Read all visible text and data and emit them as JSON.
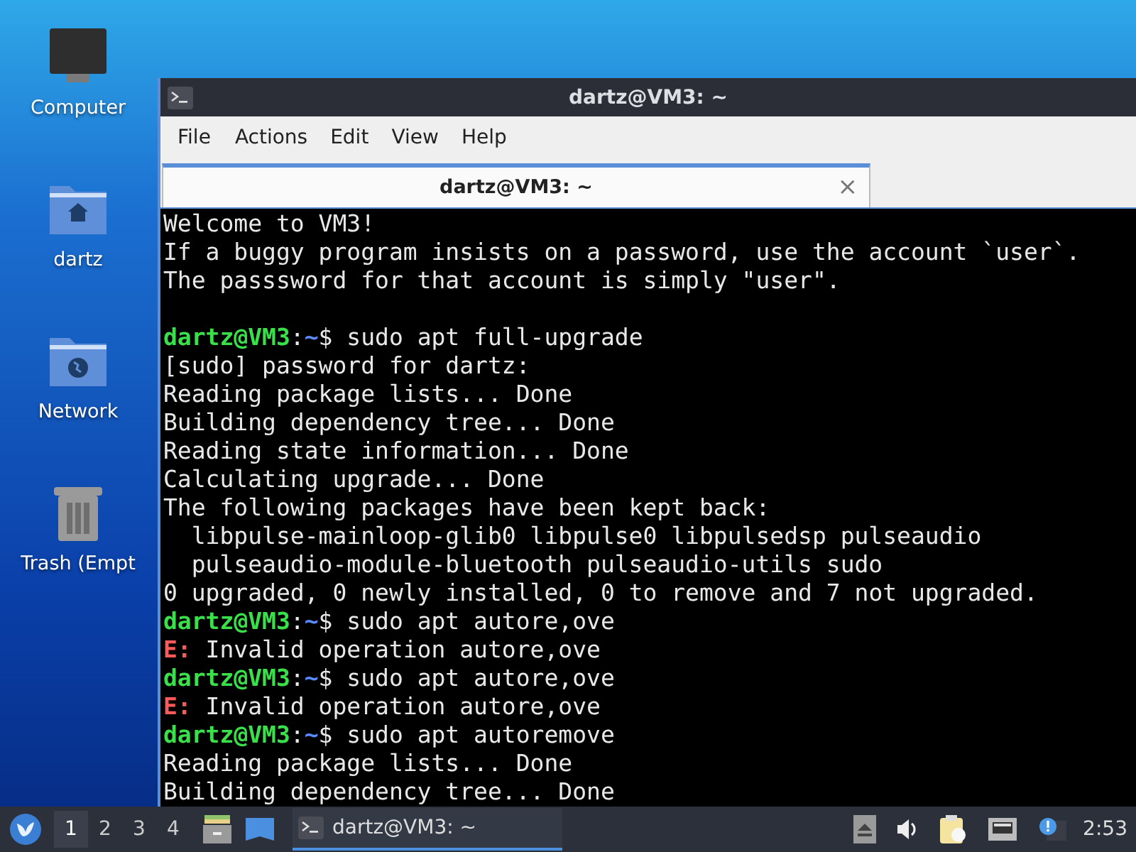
{
  "desktop_icons": [
    {
      "kind": "computer",
      "label": "Computer"
    },
    {
      "kind": "home",
      "label": "dartz"
    },
    {
      "kind": "network",
      "label": "Network"
    },
    {
      "kind": "trash",
      "label": "Trash (Empt"
    }
  ],
  "window": {
    "title": "dartz@VM3: ~"
  },
  "menu": [
    "File",
    "Actions",
    "Edit",
    "View",
    "Help"
  ],
  "tabs": [
    {
      "label": "dartz@VM3: ~",
      "close": "×",
      "selected": true
    }
  ],
  "terminal_lines": [
    {
      "kind": "plain",
      "text": "Welcome to VM3!"
    },
    {
      "kind": "plain",
      "text": "If a buggy program insists on a password, use the account `user`."
    },
    {
      "kind": "plain",
      "text": "The passsword for that account is simply \"user\"."
    },
    {
      "kind": "blank"
    },
    {
      "kind": "prompt",
      "user": "dartz@VM3",
      "sep": ":",
      "path": "~",
      "command": "$ sudo apt full-upgrade"
    },
    {
      "kind": "plain",
      "text": "[sudo] password for dartz:"
    },
    {
      "kind": "plain",
      "text": "Reading package lists... Done"
    },
    {
      "kind": "plain",
      "text": "Building dependency tree... Done"
    },
    {
      "kind": "plain",
      "text": "Reading state information... Done"
    },
    {
      "kind": "plain",
      "text": "Calculating upgrade... Done"
    },
    {
      "kind": "plain",
      "text": "The following packages have been kept back:"
    },
    {
      "kind": "indented",
      "text": "libpulse-mainloop-glib0 libpulse0 libpulsedsp pulseaudio"
    },
    {
      "kind": "indented",
      "text": "pulseaudio-module-bluetooth pulseaudio-utils sudo"
    },
    {
      "kind": "plain",
      "text": "0 upgraded, 0 newly installed, 0 to remove and 7 not upgraded."
    },
    {
      "kind": "prompt",
      "user": "dartz@VM3",
      "sep": ":",
      "path": "~",
      "command": "$ sudo apt autore,ove"
    },
    {
      "kind": "error",
      "prefix": "E:",
      "text": "Invalid operation autore,ove"
    },
    {
      "kind": "prompt",
      "user": "dartz@VM3",
      "sep": ":",
      "path": "~",
      "command": "$ sudo apt autore,ove"
    },
    {
      "kind": "error",
      "prefix": "E:",
      "text": "Invalid operation autore,ove"
    },
    {
      "kind": "prompt",
      "user": "dartz@VM3",
      "sep": ":",
      "path": "~",
      "command": "$ sudo apt autoremove"
    },
    {
      "kind": "plain",
      "text": "Reading package lists... Done"
    },
    {
      "kind": "plain",
      "text": "Building dependency tree... Done"
    }
  ],
  "taskbar": {
    "workspaces": [
      {
        "label": "1",
        "selected": true
      },
      {
        "label": "2",
        "selected": false
      },
      {
        "label": "3",
        "selected": false
      },
      {
        "label": "4",
        "selected": false
      }
    ],
    "tasks": [
      {
        "label": "dartz@VM3: ~",
        "selected": true
      }
    ],
    "clock": "2:53"
  }
}
